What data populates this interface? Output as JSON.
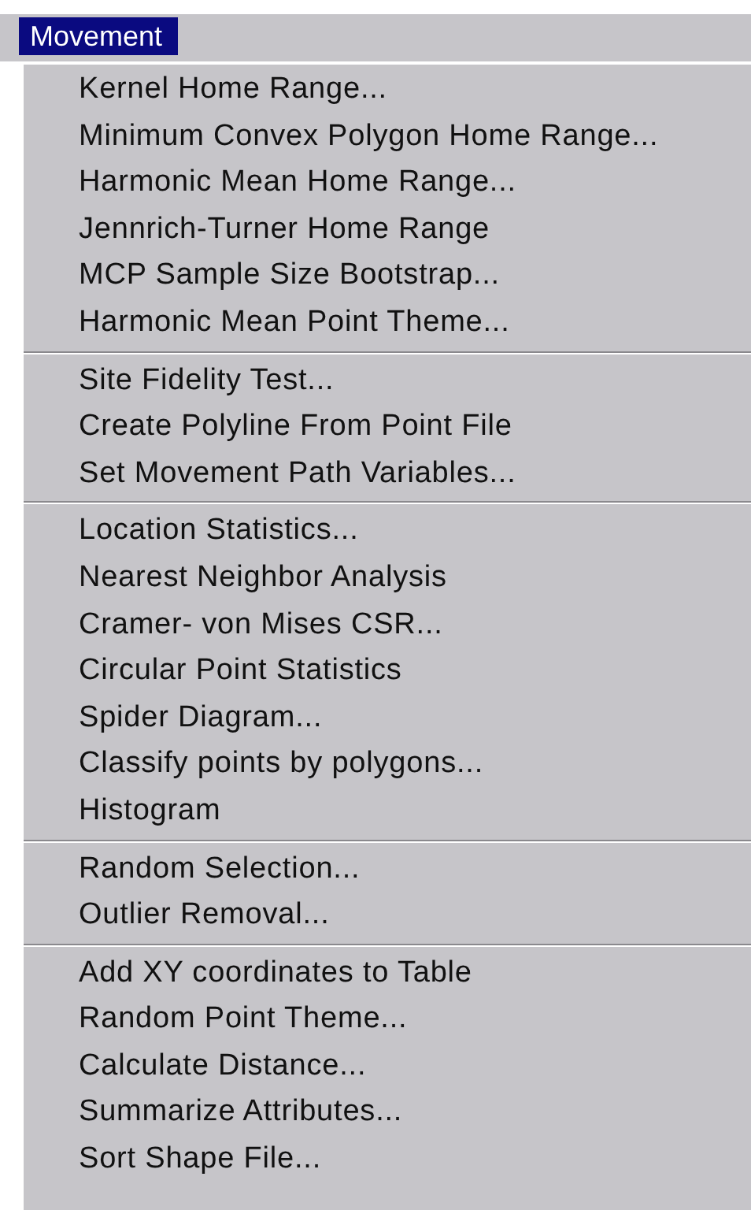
{
  "menu_title": {
    "label": "Movement",
    "selected": true
  },
  "groups": [
    {
      "items": [
        "Kernel Home Range...",
        "Minimum Convex Polygon Home Range...",
        "Harmonic Mean Home Range...",
        "Jennrich-Turner Home Range",
        "MCP Sample Size Bootstrap...",
        "Harmonic Mean Point Theme..."
      ]
    },
    {
      "items": [
        "Site Fidelity Test...",
        "Create Polyline From Point File",
        "Set Movement Path Variables..."
      ]
    },
    {
      "items": [
        "Location Statistics...",
        "Nearest Neighbor Analysis",
        "Cramer- von Mises CSR...",
        "Circular Point Statistics",
        "Spider Diagram...",
        "Classify points by polygons...",
        "Histogram"
      ]
    },
    {
      "items": [
        "Random Selection...",
        "Outlier Removal..."
      ]
    },
    {
      "items": [
        "Add XY coordinates to Table",
        "Random Point Theme...",
        "Calculate Distance...",
        "Summarize Attributes...",
        "Sort Shape File..."
      ]
    }
  ]
}
